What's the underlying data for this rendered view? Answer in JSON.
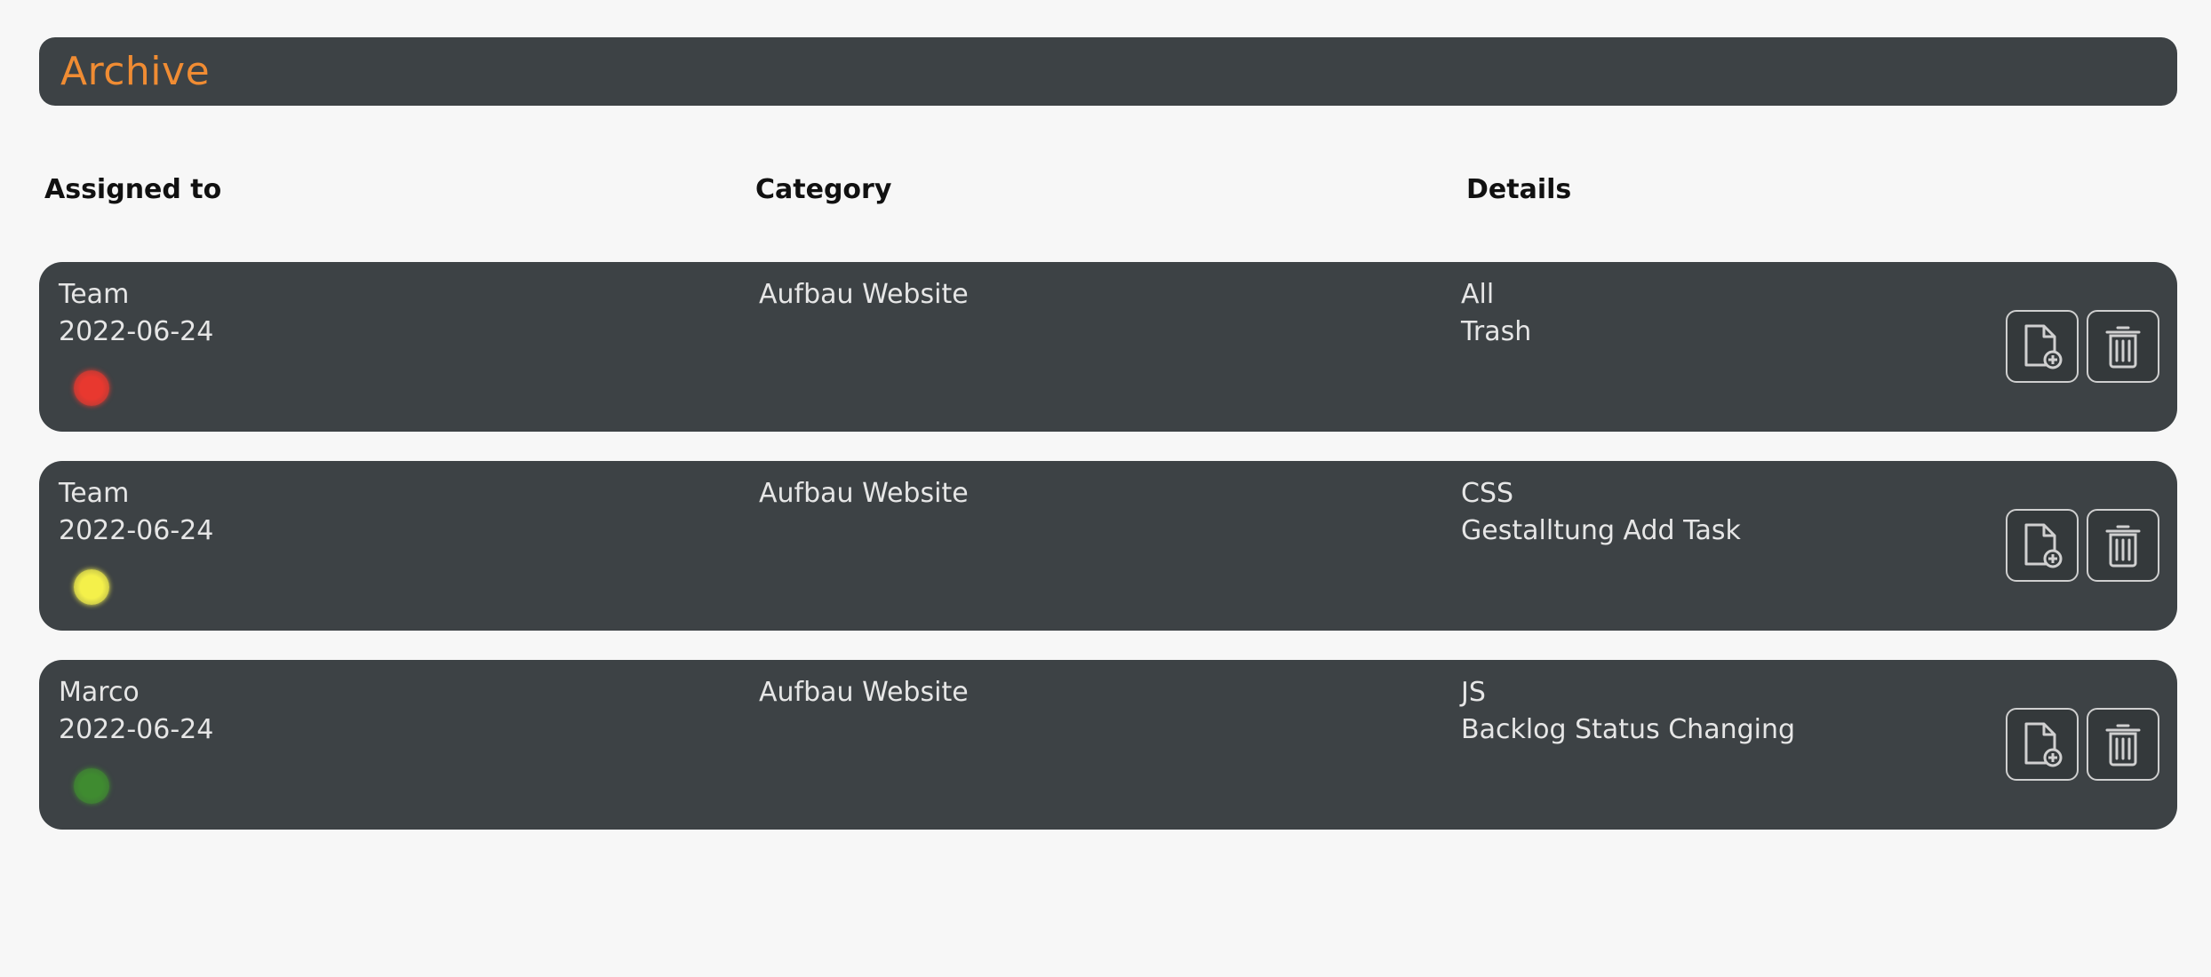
{
  "header": {
    "title": "Archive"
  },
  "columns": {
    "assigned": "Assigned to",
    "category": "Category",
    "details": "Details"
  },
  "rows": [
    {
      "assignee": "Team",
      "date": "2022-06-24",
      "category": "Aufbau Website",
      "detail_title": "All",
      "detail_desc": "Trash",
      "priority_color": "#e8382f"
    },
    {
      "assignee": "Team",
      "date": "2022-06-24",
      "category": "Aufbau Website",
      "detail_title": "CSS",
      "detail_desc": "Gestalltung Add Task",
      "priority_color": "#f4f04a"
    },
    {
      "assignee": "Marco",
      "date": "2022-06-24",
      "category": "Aufbau Website",
      "detail_title": "JS",
      "detail_desc": "Backlog Status Changing",
      "priority_color": "#3f8b30"
    }
  ],
  "icons": {
    "restore": "file-plus-icon",
    "delete": "trash-icon"
  },
  "colors": {
    "accent": "#f08c33",
    "panel": "#3d4245",
    "background": "#f7f7f7"
  }
}
